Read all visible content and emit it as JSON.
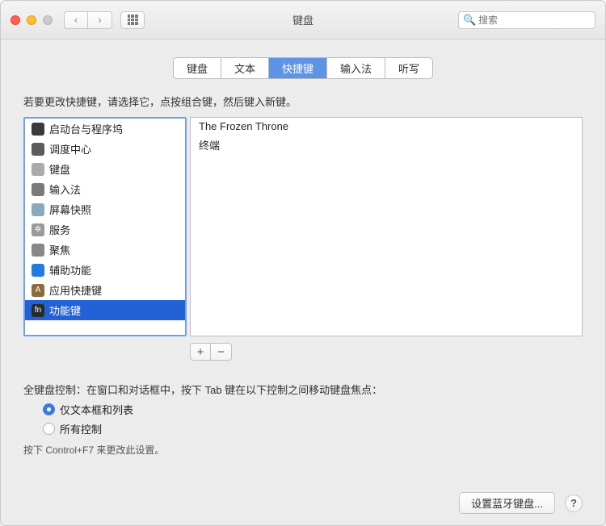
{
  "window": {
    "title": "键盘"
  },
  "search": {
    "placeholder": "搜索"
  },
  "tabs": [
    {
      "label": "键盘",
      "active": false
    },
    {
      "label": "文本",
      "active": false
    },
    {
      "label": "快捷键",
      "active": true
    },
    {
      "label": "输入法",
      "active": false
    },
    {
      "label": "听写",
      "active": false
    }
  ],
  "shortcuts": {
    "hint": "若要更改快捷键，请选择它，点按组合键，然后键入新键。",
    "categories": [
      {
        "label": "启动台与程序坞",
        "icon_bg": "#3a3a3a",
        "icon_char": ""
      },
      {
        "label": "调度中心",
        "icon_bg": "#5b5b5b",
        "icon_char": ""
      },
      {
        "label": "键盘",
        "icon_bg": "#aaaaaa",
        "icon_char": ""
      },
      {
        "label": "输入法",
        "icon_bg": "#7a7a7a",
        "icon_char": ""
      },
      {
        "label": "屏幕快照",
        "icon_bg": "#8ca8bd",
        "icon_char": ""
      },
      {
        "label": "服务",
        "icon_bg": "#9a9a9a",
        "icon_char": "✲"
      },
      {
        "label": "聚焦",
        "icon_bg": "#888888",
        "icon_char": ""
      },
      {
        "label": "辅助功能",
        "icon_bg": "#1f7de0",
        "icon_char": ""
      },
      {
        "label": "应用快捷键",
        "icon_bg": "#8b6b3b",
        "icon_char": "A"
      },
      {
        "label": "功能键",
        "icon_bg": "#2a2a2a",
        "icon_char": "fn",
        "selected": true
      }
    ],
    "right_items": [
      {
        "label": "The Frozen Throne"
      },
      {
        "label": "终端"
      }
    ],
    "plus": "+",
    "minus": "−"
  },
  "keyboard_control": {
    "label": "全键盘控制：在窗口和对话框中，按下 Tab 键在以下控制之间移动键盘焦点：",
    "options": [
      {
        "label": "仅文本框和列表",
        "selected": true
      },
      {
        "label": "所有控制",
        "selected": false
      }
    ],
    "sub_hint": "按下 Control+F7 来更改此设置。"
  },
  "footer": {
    "bluetooth_button": "设置蓝牙键盘...",
    "help": "?"
  }
}
